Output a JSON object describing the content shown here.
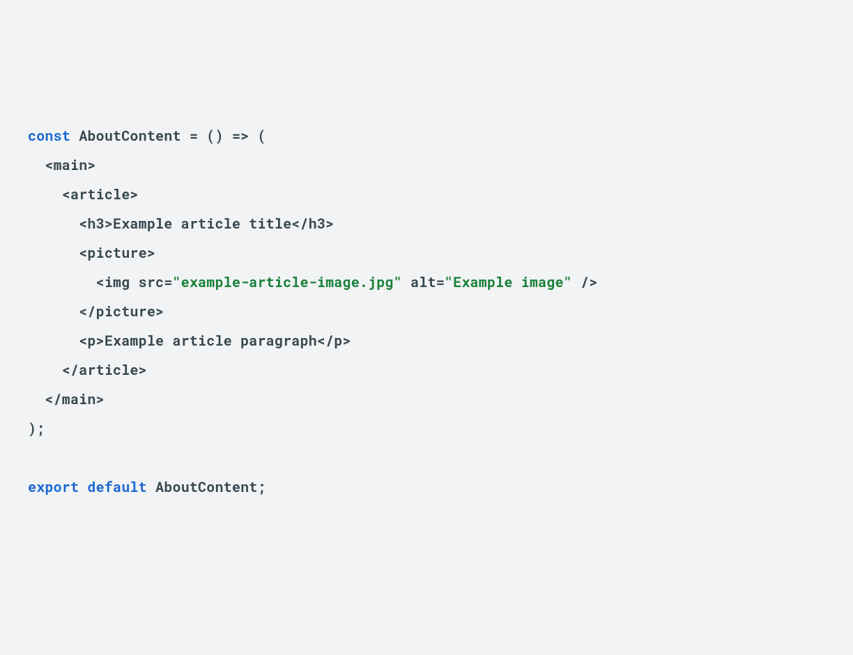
{
  "code": {
    "l1": {
      "kw_const": "const",
      "name": "AboutContent",
      "eq": " = ",
      "arrow": "() => ("
    },
    "l2": {
      "open_main": "<main>"
    },
    "l3": {
      "open_article": "<article>"
    },
    "l4": {
      "h3_open": "<h3>",
      "h3_text": "Example article title",
      "h3_close": "</h3>"
    },
    "l5": {
      "open_picture": "<picture>"
    },
    "l6": {
      "img_open": "<img",
      "src_attr": " src=",
      "src_val": "\"example-article-image.jpg\"",
      "alt_attr": " alt=",
      "alt_val": "\"Example image\"",
      "img_close": " />"
    },
    "l7": {
      "close_picture": "</picture>"
    },
    "l8": {
      "p_open": "<p>",
      "p_text": "Example article paragraph",
      "p_close": "</p>"
    },
    "l9": {
      "close_article": "</article>"
    },
    "l10": {
      "close_main": "</main>"
    },
    "l11": {
      "paren": ");"
    },
    "l12": {
      "blank": " "
    },
    "l13": {
      "kw_export": "export",
      "kw_default": "default",
      "name": "AboutContent",
      "semi": ";"
    }
  }
}
